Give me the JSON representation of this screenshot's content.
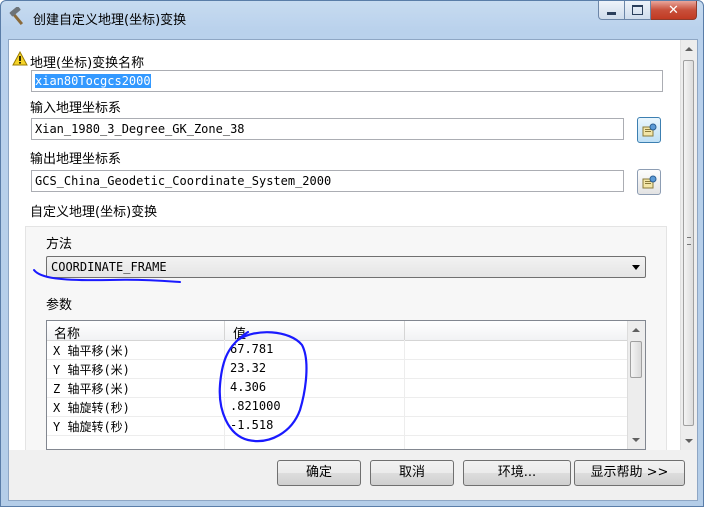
{
  "window": {
    "title": "创建自定义地理(坐标)变换",
    "tool_icon": "hammer-icon",
    "controls": {
      "minimize": "minimize-icon",
      "maximize": "maximize-icon",
      "close": "close-icon"
    }
  },
  "form": {
    "transform_name_label": "地理(坐标)变换名称",
    "transform_name_value": "xian80Tocgcs2000",
    "warning_icon": "warning-icon",
    "input_gcs_label": "输入地理坐标系",
    "input_gcs_value": "Xian_1980_3_Degree_GK_Zone_38",
    "output_gcs_label": "输出地理坐标系",
    "output_gcs_value": "GCS_China_Geodetic_Coordinate_System_2000",
    "custom_transform_label": "自定义地理(坐标)变换",
    "method_label": "方法",
    "method_value": "COORDINATE_FRAME",
    "params_label": "参数",
    "params_columns": [
      "名称",
      "值"
    ],
    "params_rows": [
      {
        "name": "X 轴平移(米)",
        "value": "67.781"
      },
      {
        "name": "Y 轴平移(米)",
        "value": "23.32"
      },
      {
        "name": "Z 轴平移(米)",
        "value": "4.306"
      },
      {
        "name": "X 轴旋转(秒)",
        "value": ".821000"
      },
      {
        "name": "Y 轴旋转(秒)",
        "value": "-1.518"
      }
    ]
  },
  "buttons": {
    "ok": "确定",
    "cancel": "取消",
    "environments": "环境...",
    "show_help": "显示帮助 >>"
  },
  "colors": {
    "selection": "#3399ff",
    "annotation_ink": "#1a1aff",
    "close_button": "#c8503b"
  }
}
